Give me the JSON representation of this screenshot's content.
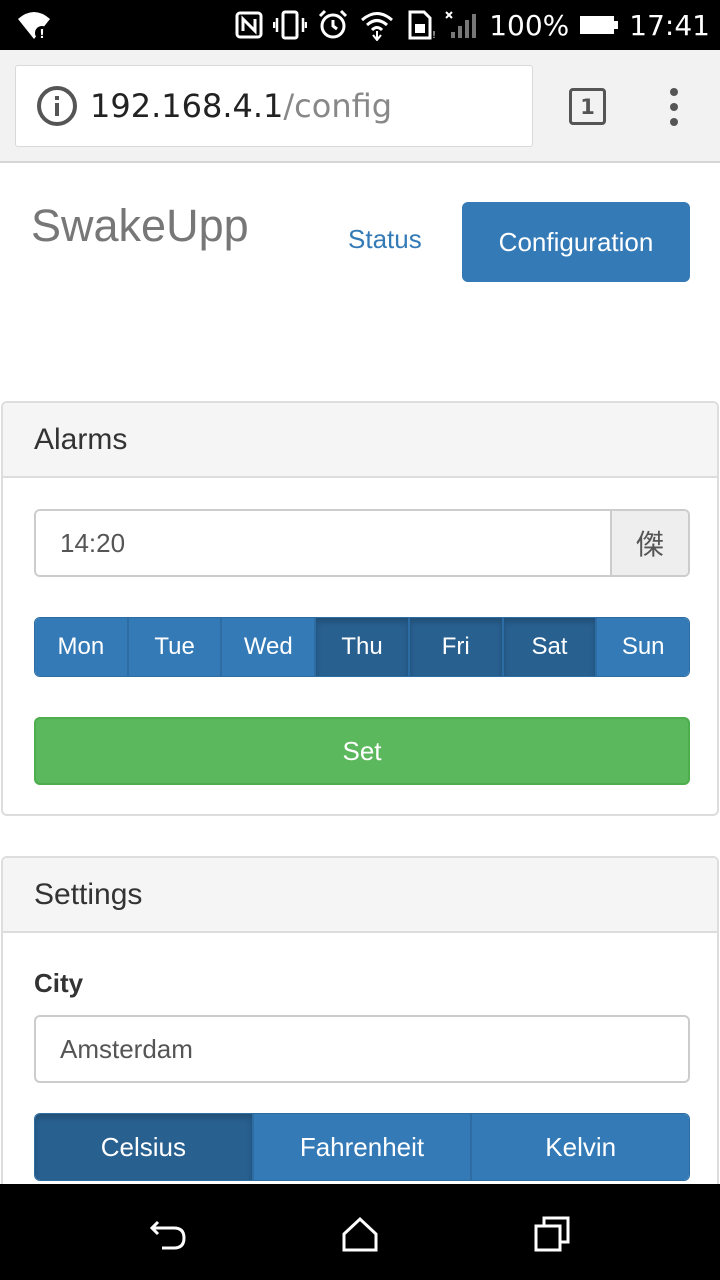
{
  "status_bar": {
    "battery": "100%",
    "time": "17:41",
    "icons": [
      "wifi-alert-icon",
      "nfc-icon",
      "vibrate-icon",
      "alarm-icon",
      "wifi-icon",
      "sim-icon",
      "signal-icon",
      "battery-icon"
    ]
  },
  "browser": {
    "url_host": "192.168.4.1",
    "url_path": "/config",
    "tab_count": "1"
  },
  "header": {
    "brand": "SwakeUpp",
    "nav_status": "Status",
    "nav_config": "Configuration"
  },
  "alarms": {
    "title": "Alarms",
    "time_value": "14:20",
    "time_addon": "傑",
    "days": [
      {
        "label": "Mon",
        "active": false
      },
      {
        "label": "Tue",
        "active": false
      },
      {
        "label": "Wed",
        "active": false
      },
      {
        "label": "Thu",
        "active": true
      },
      {
        "label": "Fri",
        "active": true
      },
      {
        "label": "Sat",
        "active": true
      },
      {
        "label": "Sun",
        "active": false
      }
    ],
    "set_label": "Set"
  },
  "settings": {
    "title": "Settings",
    "city_label": "City",
    "city_value": "Amsterdam",
    "units": [
      {
        "label": "Celsius",
        "active": true
      },
      {
        "label": "Fahrenheit",
        "active": false
      },
      {
        "label": "Kelvin",
        "active": false
      }
    ]
  },
  "colors": {
    "primary": "#337ab7",
    "primary_active": "#286090",
    "success": "#5cb85c"
  }
}
